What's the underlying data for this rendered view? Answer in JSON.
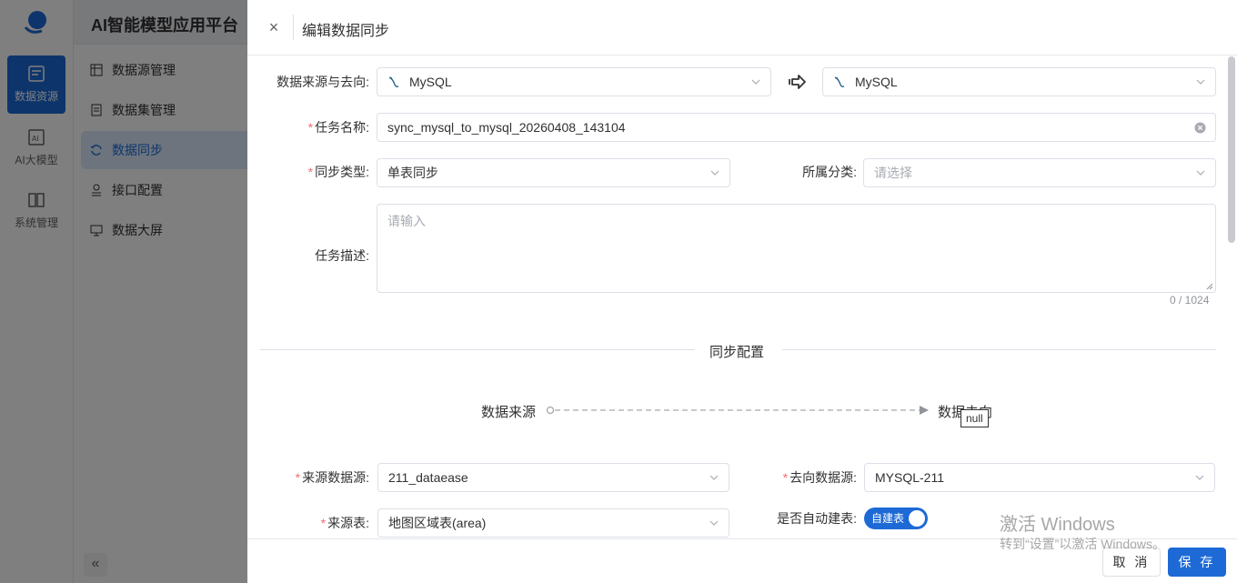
{
  "app": {
    "title": "AI智能模型应用平台",
    "rail": [
      {
        "label": "数据资源",
        "icon": "data-resource-icon",
        "active": true
      },
      {
        "label": "AI大模型",
        "icon": "ai-model-icon",
        "active": false
      },
      {
        "label": "系统管理",
        "icon": "system-manage-icon",
        "active": false
      }
    ],
    "menu": [
      {
        "label": "数据源管理",
        "icon": "datasource-icon",
        "active": false
      },
      {
        "label": "数据集管理",
        "icon": "dataset-icon",
        "active": false
      },
      {
        "label": "数据同步",
        "icon": "sync-icon",
        "active": true
      },
      {
        "label": "接口配置",
        "icon": "api-icon",
        "active": false
      },
      {
        "label": "数据大屏",
        "icon": "screen-icon",
        "active": false
      }
    ],
    "collapse_glyph": "«"
  },
  "drawer": {
    "title": "编辑数据同步",
    "close_glyph": "×",
    "source_direction": {
      "label": "数据来源与去向:",
      "source_value": "MySQL",
      "target_value": "MySQL"
    },
    "task_name": {
      "label": "任务名称:",
      "value": "sync_mysql_to_mysql_20260408_143104"
    },
    "sync_type": {
      "label": "同步类型:",
      "value": "单表同步"
    },
    "category": {
      "label": "所属分类:",
      "placeholder": "请选择"
    },
    "description": {
      "label": "任务描述:",
      "placeholder": "请输入",
      "counter": "0 / 1024"
    },
    "section_title": "同步配置",
    "flow": {
      "source_text": "数据来源",
      "target_text": "数据去向",
      "tooltip": "null"
    },
    "source_ds": {
      "label": "来源数据源:",
      "value": "211_dataease"
    },
    "target_ds": {
      "label": "去向数据源:",
      "value": "MYSQL-211"
    },
    "source_table": {
      "label": "来源表:",
      "value": "地图区域表(area)"
    },
    "auto_create": {
      "label": "是否自动建表:",
      "switch_text": "自建表",
      "on": true
    },
    "buttons": {
      "cancel": "取 消",
      "save": "保 存"
    }
  },
  "watermark": {
    "line1": "激活 Windows",
    "line2": "转到“设置”以激活 Windows。"
  },
  "colors": {
    "primary": "#1d6ad6",
    "required": "#f56c6c",
    "border": "#dcdfe6"
  }
}
